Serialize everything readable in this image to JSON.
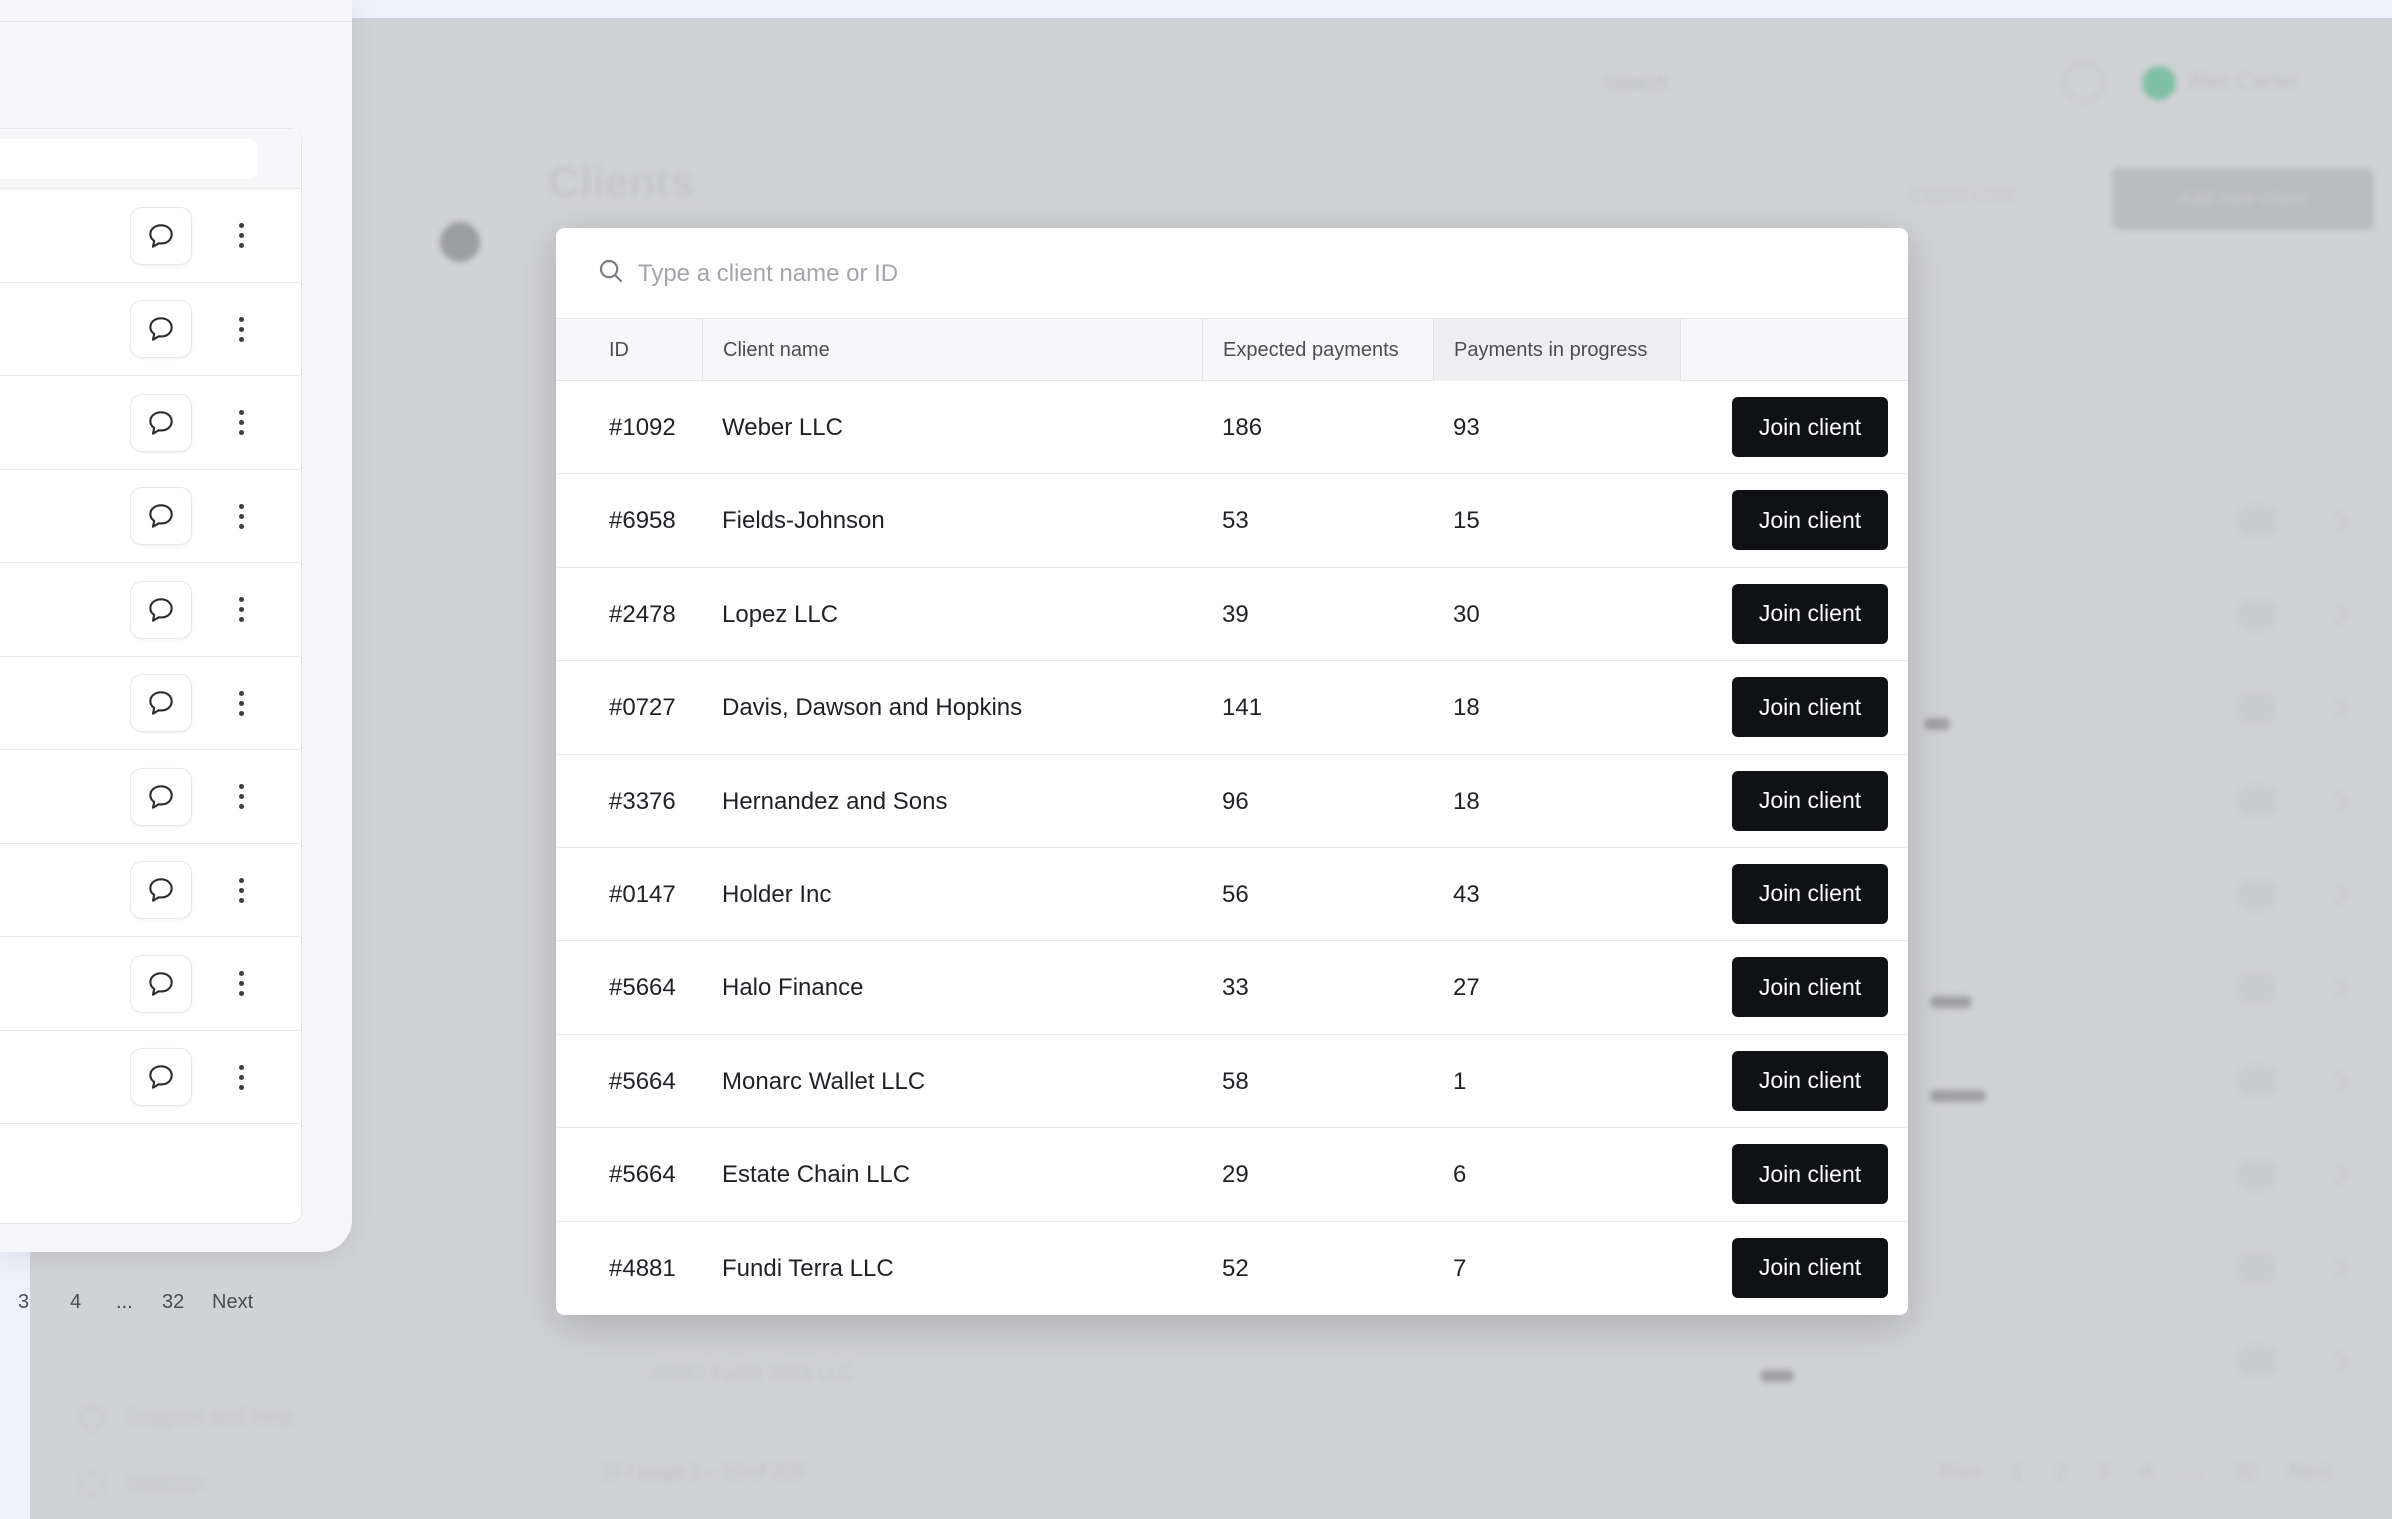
{
  "background": {
    "search_placeholder": "Search",
    "user_name": "Alex Carter",
    "page_title": "Clients",
    "export_label": "Export CSV",
    "primary_button": "Add new client",
    "last_row": "#4881   Fundi Terra LLC",
    "footer_per_page": "10 / page    1 – 10 of 320",
    "pager": "Prev 1 2 3 4 … 32 Next",
    "sidebar_support": "Support and help",
    "sidebar_settings": "Settings"
  },
  "left_panel": {
    "pager": {
      "p3": "3",
      "p4": "4",
      "ellipsis": "...",
      "last": "32",
      "next": "Next"
    }
  },
  "modal": {
    "search": {
      "placeholder": "Type a client name or ID",
      "value": ""
    },
    "columns": {
      "id": "ID",
      "name": "Client name",
      "expected": "Expected payments",
      "progress": "Payments in progress"
    },
    "rows": [
      {
        "id": "#1092",
        "name": "Weber LLC",
        "expected": "186",
        "progress": "93",
        "action": "Join client"
      },
      {
        "id": "#6958",
        "name": "Fields-Johnson",
        "expected": "53",
        "progress": "15",
        "action": "Join client"
      },
      {
        "id": "#2478",
        "name": "Lopez LLC",
        "expected": "39",
        "progress": "30",
        "action": "Join client"
      },
      {
        "id": "#0727",
        "name": "Davis, Dawson and Hopkins",
        "expected": "141",
        "progress": "18",
        "action": "Join client"
      },
      {
        "id": "#3376",
        "name": "Hernandez and Sons",
        "expected": "96",
        "progress": "18",
        "action": "Join client"
      },
      {
        "id": "#0147",
        "name": "Holder Inc",
        "expected": "56",
        "progress": "43",
        "action": "Join client"
      },
      {
        "id": "#5664",
        "name": "Halo Finance",
        "expected": "33",
        "progress": "27",
        "action": "Join client"
      },
      {
        "id": "#5664",
        "name": "Monarc Wallet LLC",
        "expected": "58",
        "progress": "1",
        "action": "Join client"
      },
      {
        "id": "#5664",
        "name": "Estate Chain LLC",
        "expected": "29",
        "progress": "6",
        "action": "Join client"
      },
      {
        "id": "#4881",
        "name": "Fundi Terra LLC",
        "expected": "52",
        "progress": "7",
        "action": "Join client"
      }
    ]
  },
  "colors": {
    "button_bg": "#0f1115",
    "overlay": "#d1d2d5",
    "page_bg": "#eef0fa"
  }
}
